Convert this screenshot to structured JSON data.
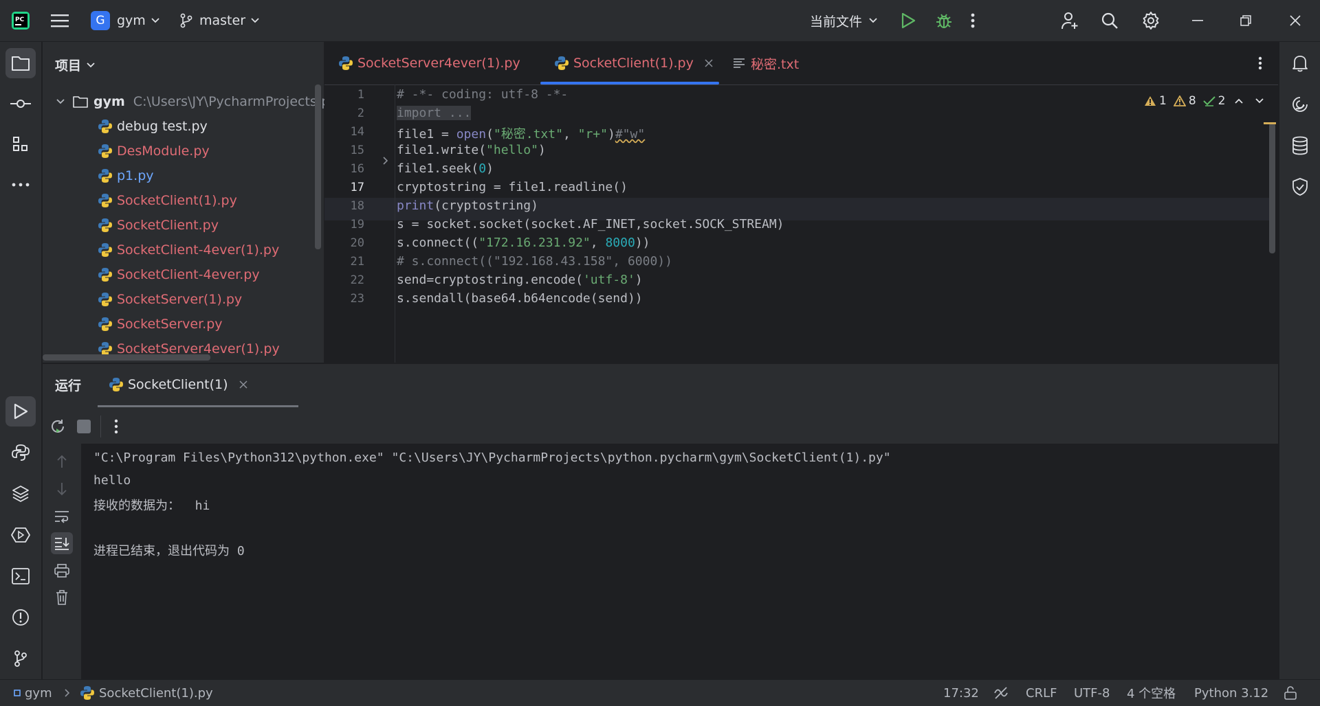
{
  "titlebar": {
    "project_badge": "G",
    "project_name": "gym",
    "branch": "master",
    "run_config": "当前文件"
  },
  "project_panel": {
    "title": "项目",
    "root_name": "gym",
    "root_path": "C:\\Users\\JY\\PycharmProjects\\p",
    "files": [
      {
        "name": "debug test.py",
        "color": "#dfe1e5"
      },
      {
        "name": "DesModule.py",
        "color": "#e06c75"
      },
      {
        "name": "p1.py",
        "color": "#6ea8ff"
      },
      {
        "name": "SocketClient(1).py",
        "color": "#e06c75"
      },
      {
        "name": "SocketClient.py",
        "color": "#e06c75"
      },
      {
        "name": "SocketClient-4ever(1).py",
        "color": "#e06c75"
      },
      {
        "name": "SocketClient-4ever.py",
        "color": "#e06c75"
      },
      {
        "name": "SocketServer(1).py",
        "color": "#e06c75"
      },
      {
        "name": "SocketServer.py",
        "color": "#e06c75"
      },
      {
        "name": "SocketServer4ever(1).py",
        "color": "#e06c75"
      }
    ]
  },
  "editor": {
    "tabs": [
      {
        "label": "SocketServer4ever(1).py"
      },
      {
        "label": "SocketClient(1).py"
      },
      {
        "label": "秘密.txt"
      }
    ],
    "inspections": {
      "errors": "1",
      "warnings": "8",
      "weak": "2"
    },
    "line_numbers": [
      "1",
      "2",
      "14",
      "15",
      "16",
      "17",
      "18",
      "19",
      "20",
      "21",
      "22",
      "23"
    ],
    "code": {
      "l1": "# -*- coding: utf-8 -*-",
      "l2": "import ...",
      "l14_a": "file1 = ",
      "l14_b": "open",
      "l14_c": "(",
      "l14_d": "\"秘密.txt\"",
      "l14_e": ", ",
      "l14_f": "\"r+\"",
      "l14_g": ")",
      "l14_h": "#\"w\"",
      "l15_a": "file1.write(",
      "l15_b": "\"hello\"",
      "l15_c": ")",
      "l16_a": "file1.seek(",
      "l16_b": "0",
      "l16_c": ")",
      "l17": "cryptostring = file1.readline()",
      "l18_a": "print",
      "l18_b": "(cryptostring)",
      "l19": "s = socket.socket(socket.AF_INET,socket.SOCK_STREAM)",
      "l20_a": "s.connect((",
      "l20_b": "\"172.16.231.92\"",
      "l20_c": ", ",
      "l20_d": "8000",
      "l20_e": "))",
      "l21": "# s.connect((\"192.168.43.158\", 6000))",
      "l22_a": "send=cryptostring.encode(",
      "l22_b": "'utf-8'",
      "l22_c": ")",
      "l23": "s.sendall(base64.b64encode(send))"
    }
  },
  "run_panel": {
    "title": "运行",
    "tab_label": "SocketClient(1)",
    "console": {
      "cmd": "\"C:\\Program Files\\Python312\\python.exe\" \"C:\\Users\\JY\\PycharmProjects\\python.pycharm\\gym\\SocketClient(1).py\"",
      "out1": "hello",
      "out2": "接收的数据为：  hi",
      "out3": "进程已结束，退出代码为 0"
    }
  },
  "statusbar": {
    "project": "gym",
    "file": "SocketClient(1).py",
    "position": "17:32",
    "line_sep": "CRLF",
    "encoding": "UTF-8",
    "indent": "4 个空格",
    "interpreter": "Python 3.12"
  },
  "colors": {
    "accent": "#3574f0",
    "modified_file": "#e06c75",
    "run_green": "#5fb865"
  }
}
